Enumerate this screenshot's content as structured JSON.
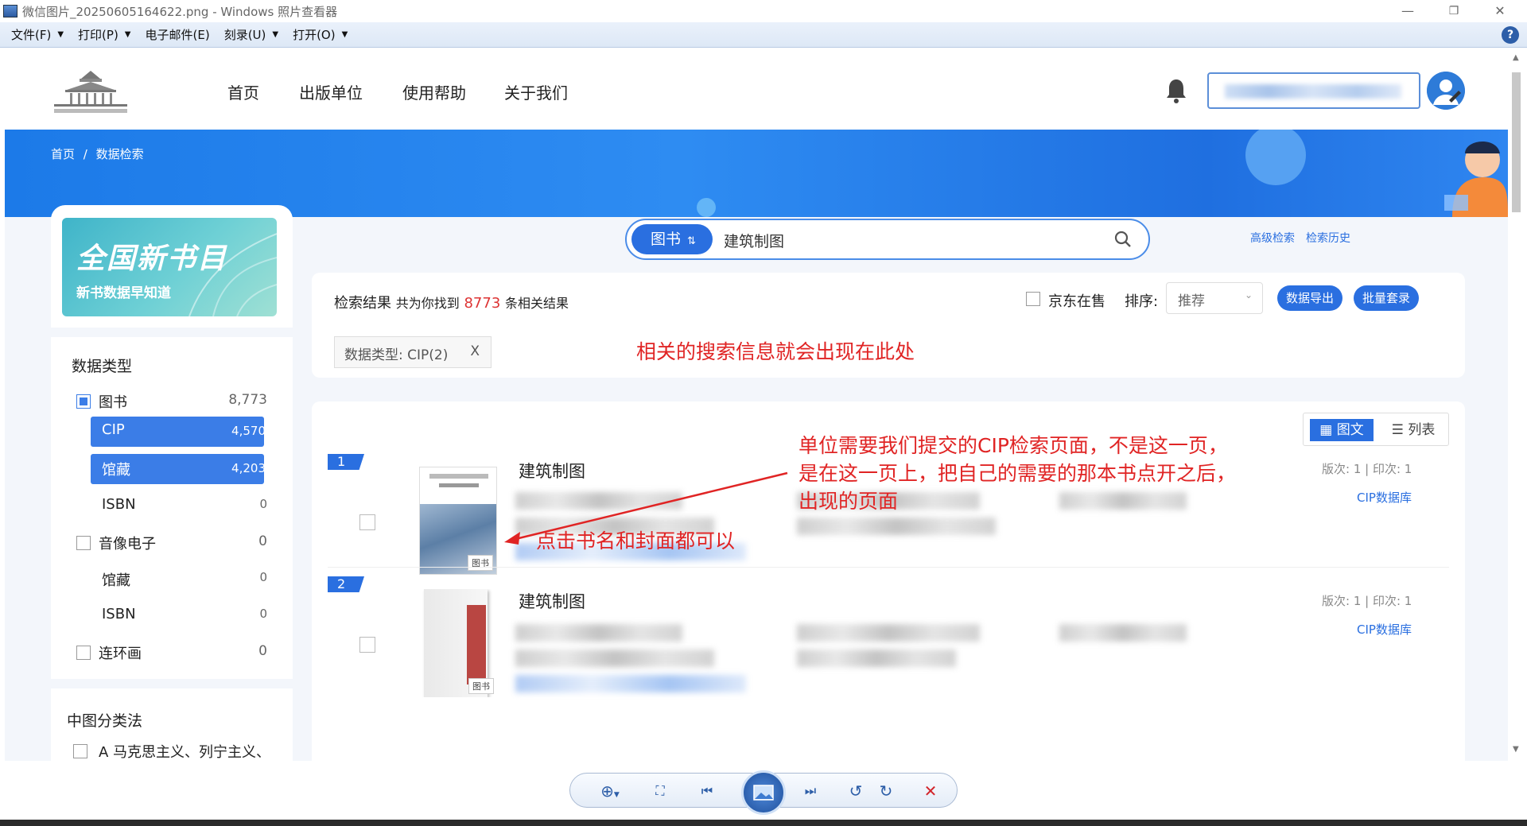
{
  "window": {
    "title": "微信图片_20250605164622.png - Windows 照片查看器",
    "minimize": "—",
    "restore": "❐",
    "close": "✕"
  },
  "menubar": {
    "file": "文件(F)",
    "print": "打印(P)",
    "email": "电子邮件(E)",
    "burn": "刻录(U)",
    "open": "打开(O)",
    "help": "?"
  },
  "site": {
    "nav": [
      "首页",
      "出版单位",
      "使用帮助",
      "关于我们"
    ],
    "breadcrumb": [
      "首页",
      "/",
      "数据检索"
    ]
  },
  "promo": {
    "title": "全国新书目",
    "subtitle": "新书数据早知道"
  },
  "sidebar": {
    "data_type_heading": "数据类型",
    "rows": [
      {
        "label": "图书",
        "count": "8,773"
      },
      {
        "label": "CIP",
        "count": "4,570"
      },
      {
        "label": "馆藏",
        "count": "4,203"
      },
      {
        "label": "ISBN",
        "count": "0"
      },
      {
        "label": "音像电子",
        "count": "0"
      },
      {
        "label": "馆藏",
        "count": "0"
      },
      {
        "label": "ISBN",
        "count": "0"
      },
      {
        "label": "连环画",
        "count": "0"
      }
    ],
    "class_heading": "中图分类法",
    "class_first": "A 马克思主义、列宁主义、"
  },
  "search": {
    "type": "图书",
    "type_arrow": "⇅",
    "query": "建筑制图",
    "advanced": "高级检索",
    "history": "检索历史"
  },
  "results_header": {
    "label": "检索结果",
    "found_prefix": "共为你找到",
    "count": "8773",
    "found_suffix": "条相关结果",
    "jd": "京东在售",
    "sort_label": "排序:",
    "sort_value": "推荐",
    "export": "数据导出",
    "batch": "批量套录",
    "filter_tag": "数据类型: CIP(2)",
    "filter_close": "X"
  },
  "view_toggle": {
    "grid": "图文",
    "list": "列表"
  },
  "results": [
    {
      "rank": "1",
      "title": "建筑制图",
      "edition": "版次: 1 | 印次: 1",
      "source": "CIP数据库",
      "cover_tag": "图书"
    },
    {
      "rank": "2",
      "title": "建筑制图",
      "edition": "版次: 1 | 印次: 1",
      "source": "CIP数据库",
      "cover_tag": "图书"
    }
  ],
  "annotations": {
    "a1": "相关的搜索信息就会出现在此处",
    "a2_line1": "单位需要我们提交的CIP检索页面，不是这一页，",
    "a2_line2": "是在这一页上，把自己的需要的那本书点开之后，",
    "a2_line3": "出现的页面",
    "a3": "点击书名和封面都可以"
  },
  "colors": {
    "accent": "#2a6fe0",
    "annotation": "#e02424",
    "banner": "#1c7ae8"
  }
}
